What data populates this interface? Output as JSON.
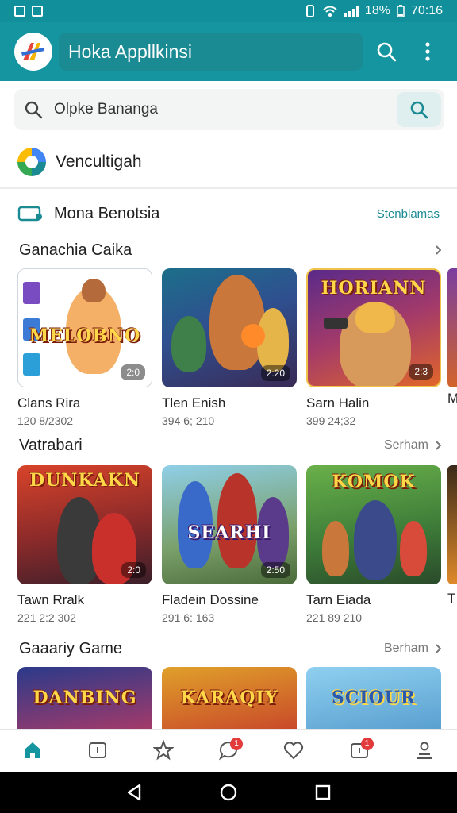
{
  "status_bar": {
    "battery": "18%",
    "time": "70:16"
  },
  "app_bar": {
    "title": "Hoka Appllkinsi"
  },
  "search": {
    "value": "Olpke Bananga"
  },
  "account": {
    "label": "Vencultigah"
  },
  "section": {
    "label": "Mona Benotsia",
    "link": "Stenblamas"
  },
  "categories": [
    {
      "title": "Ganachia Caika",
      "more": "",
      "items": [
        {
          "name": "Clans Rira",
          "meta": "120 8/2302",
          "art": "MELOBNO",
          "badge": "2:0"
        },
        {
          "name": "Tlen Enish",
          "meta": "394 6; 210",
          "art": "",
          "badge": "2:20"
        },
        {
          "name": "Sarn Halin",
          "meta": "399 24;32",
          "art": "HORIANN",
          "badge": "2:3"
        }
      ],
      "peek_name": "M"
    },
    {
      "title": "Vatrabari",
      "more": "Serham",
      "items": [
        {
          "name": "Tawn Rralk",
          "meta": "221 2:2 302",
          "art": "DUNKAKN",
          "badge": "2:0"
        },
        {
          "name": "Fladein Dossine",
          "meta": "291 6: 163",
          "art": "SEARHI",
          "badge": "2:50"
        },
        {
          "name": "Tarn Eiada",
          "meta": "221 89 210",
          "art": "KOMOK",
          "badge": ""
        }
      ],
      "peek_name": "T"
    },
    {
      "title": "Gaaariy Game",
      "more": "Berham",
      "items": [
        {
          "name": "",
          "meta": "",
          "art": "DANBING",
          "badge": ""
        },
        {
          "name": "",
          "meta": "",
          "art": "KARAQIY",
          "badge": ""
        },
        {
          "name": "",
          "meta": "",
          "art": "SCIOUR",
          "badge": ""
        }
      ]
    }
  ],
  "nav": {
    "messages_count": "1",
    "updates_count": "1"
  },
  "colors": {
    "primary": "#15959f",
    "accent": "#1a8a93",
    "badge": "#e33b3b"
  }
}
